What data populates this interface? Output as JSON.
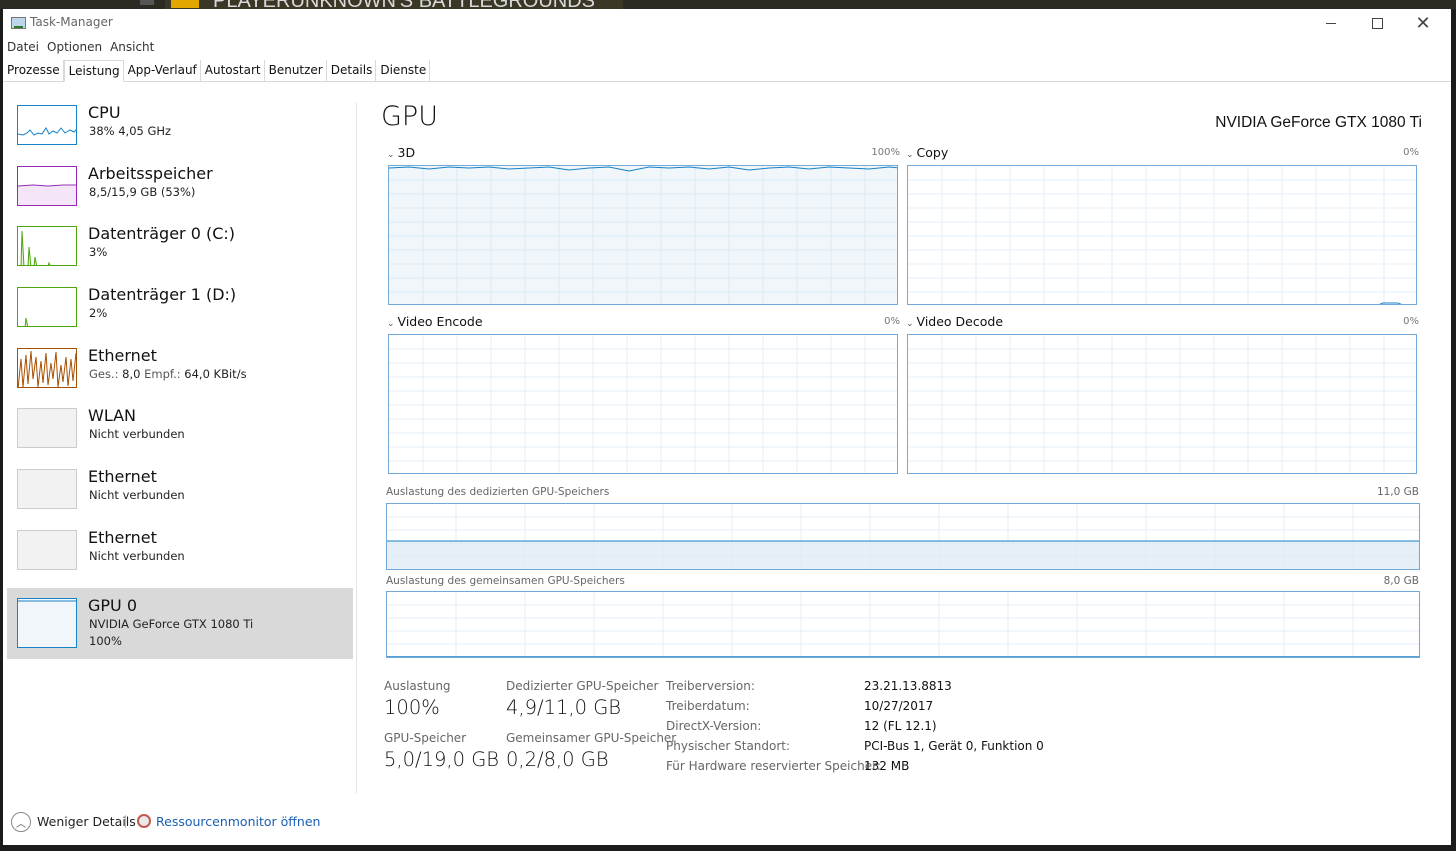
{
  "background": {
    "game_title": "PLAYERUNKNOWN'S BATTLEGROUNDS"
  },
  "window": {
    "title": "Task-Manager"
  },
  "menu": [
    "Datei",
    "Optionen",
    "Ansicht"
  ],
  "tabs": [
    "Prozesse",
    "Leistung",
    "App-Verlauf",
    "Autostart",
    "Benutzer",
    "Details",
    "Dienste"
  ],
  "active_tab": "Leistung",
  "sidebar": [
    {
      "title": "CPU",
      "subtitle": "38% 4,05 GHz",
      "color": "#1782c6"
    },
    {
      "title": "Arbeitsspeicher",
      "subtitle": "8,5/15,9 GB (53%)",
      "color": "#9528b4"
    },
    {
      "title": "Datenträger 0 (C:)",
      "subtitle": "3%",
      "color": "#4da60c"
    },
    {
      "title": "Datenträger 1 (D:)",
      "subtitle": "2%",
      "color": "#4da60c"
    },
    {
      "title": "Ethernet",
      "subtitle_label_send": "Ges.:",
      "subtitle_send": "8,0",
      "subtitle_label_recv": "Empf.:",
      "subtitle_recv": "64,0 KBit/s",
      "color": "#a74f01"
    },
    {
      "title": "WLAN",
      "subtitle": "Nicht verbunden"
    },
    {
      "title": "Ethernet",
      "subtitle": "Nicht verbunden"
    },
    {
      "title": "Ethernet",
      "subtitle": "Nicht verbunden"
    },
    {
      "title": "GPU 0",
      "subtitle": "NVIDIA GeForce GTX 1080 Ti",
      "subtitle2": "100%",
      "selected": true,
      "color": "#1782c6"
    }
  ],
  "detail": {
    "heading": "GPU",
    "device_name": "NVIDIA GeForce GTX 1080 Ti",
    "engines": [
      {
        "name": "3D",
        "percent": "100%"
      },
      {
        "name": "Copy",
        "percent": "0%"
      },
      {
        "name": "Video Encode",
        "percent": "0%"
      },
      {
        "name": "Video Decode",
        "percent": "0%"
      }
    ],
    "dedicated_mem_label": "Auslastung des dedizierten GPU-Speichers",
    "dedicated_mem_max": "11,0 GB",
    "shared_mem_label": "Auslastung des gemeinsamen GPU-Speichers",
    "shared_mem_max": "8,0 GB",
    "stats": {
      "utilization_label": "Auslastung",
      "utilization": "100%",
      "dedicated_label": "Dedizierter GPU-Speicher",
      "dedicated": "4,9/11,0 GB",
      "gpu_mem_label": "GPU-Speicher",
      "gpu_mem": "5,0/19,0 GB",
      "shared_label": "Gemeinsamer GPU-Speicher",
      "shared": "0,2/8,0 GB"
    },
    "info": [
      {
        "label": "Treiberversion:",
        "value": "23.21.13.8813"
      },
      {
        "label": "Treiberdatum:",
        "value": "10/27/2017"
      },
      {
        "label": "DirectX-Version:",
        "value": "12 (FL 12.1)"
      },
      {
        "label": "Physischer Standort:",
        "value": "PCI-Bus 1, Gerät 0, Funktion 0"
      },
      {
        "label": "Für Hardware reservierter Speicher:",
        "value": "132 MB"
      }
    ]
  },
  "footer": {
    "fewer_details": "Weniger Details",
    "resource_monitor": "Ressourcenmonitor öffnen"
  },
  "colors": {
    "gpu_line": "#1782c6",
    "gpu_fill": "#f1f6fa",
    "grid": "#d9eaf6"
  }
}
